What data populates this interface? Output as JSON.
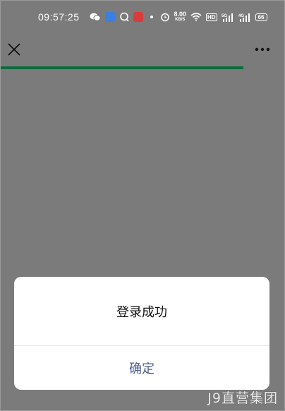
{
  "status_bar": {
    "time": "09:57:25",
    "net_speed_value": "8.00",
    "net_speed_unit": "KB/S",
    "hd_label": "HD",
    "signal_1_label": "5G",
    "signal_2_label": "4G",
    "battery_level": "66",
    "icons": [
      "wechat-icon",
      "app-icon",
      "chat-bubble-icon",
      "red-app-icon",
      "dot-icon",
      "alarm-icon",
      "wifi-icon",
      "hd-icon",
      "signal-icon",
      "signal-icon",
      "battery-icon"
    ]
  },
  "nav": {
    "close_icon": "close-icon",
    "more_icon": "more-icon"
  },
  "progress": {
    "fraction": 0.855,
    "color": "#0a6b3c"
  },
  "dialog": {
    "message": "登录成功",
    "confirm_label": "确定",
    "confirm_color": "#4a5c8e"
  },
  "watermark": {
    "text": "J9直营集团"
  }
}
